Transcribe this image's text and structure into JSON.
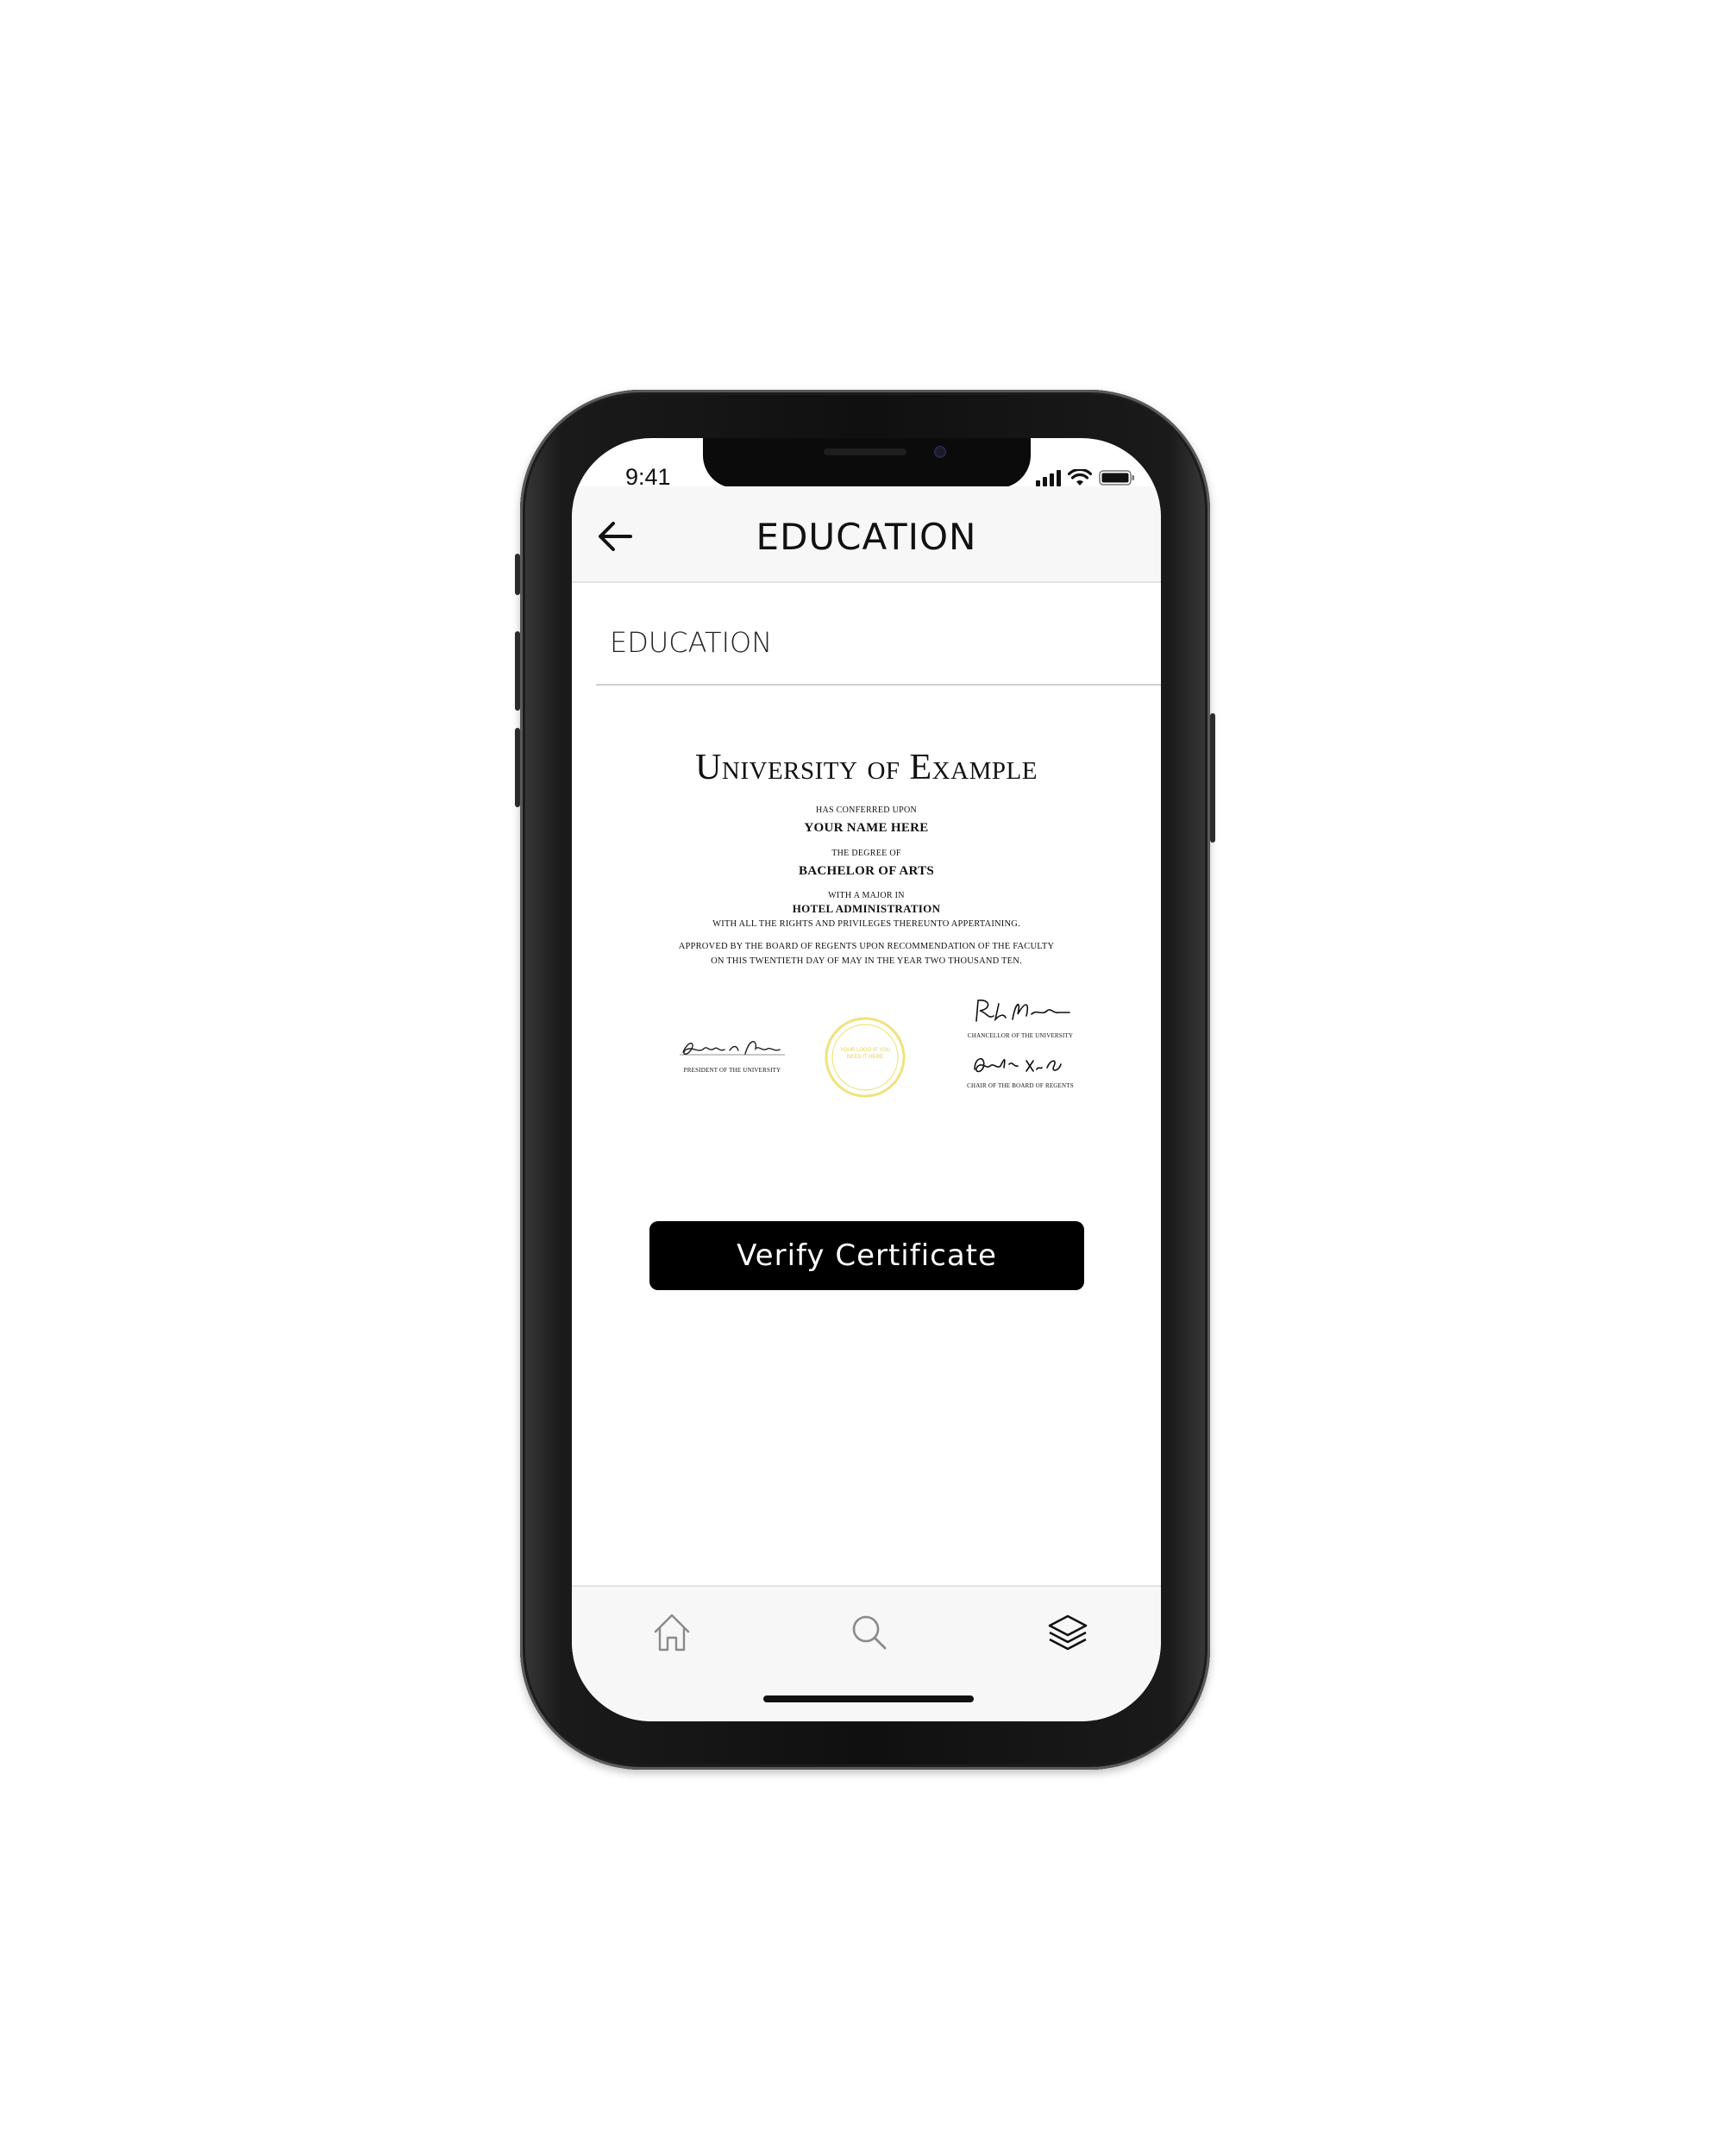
{
  "status_bar": {
    "time": "9:41"
  },
  "header": {
    "title": "EDUCATION",
    "back_icon": "arrow-left-icon"
  },
  "section": {
    "title": "EDUCATION"
  },
  "certificate": {
    "university": "University of Example",
    "conferred": "HAS CONFERRED UPON",
    "name": "YOUR NAME HERE",
    "degree_intro": "THE DEGREE OF",
    "degree": "BACHELOR OF ARTS",
    "major_intro": "WITH A MAJOR IN",
    "major": "HOTEL ADMINISTRATION",
    "rights": "WITH ALL THE RIGHTS AND PRIVILEGES THEREUNTO APPERTAINING.",
    "approved_1": "APPROVED BY THE BOARD OF REGENTS UPON RECOMMENDATION OF THE FACULTY",
    "approved_2": "ON THIS TWENTIETH DAY OF MAY IN THE YEAR TWO THOUSAND TEN.",
    "seal_text_1": "YOUR LOGO IF YOU",
    "seal_text_2": "NEED IT HERE",
    "signatures": {
      "president": "PRESIDENT OF THE UNIVERSITY",
      "chancellor": "CHANCELLOR OF THE UNIVERSITY",
      "chair": "CHAIR OF THE BOARD OF REGENTS"
    },
    "seal_color": "#f2e27a"
  },
  "verify_button": {
    "label": "Verify Certificate"
  },
  "tabbar": {
    "items": [
      {
        "icon": "home-icon",
        "active": false
      },
      {
        "icon": "search-icon",
        "active": false
      },
      {
        "icon": "layers-icon",
        "active": true
      }
    ]
  },
  "colors": {
    "accent": "#000000",
    "bar_bg": "#f7f7f7",
    "inactive_icon": "#8a8a8a"
  }
}
